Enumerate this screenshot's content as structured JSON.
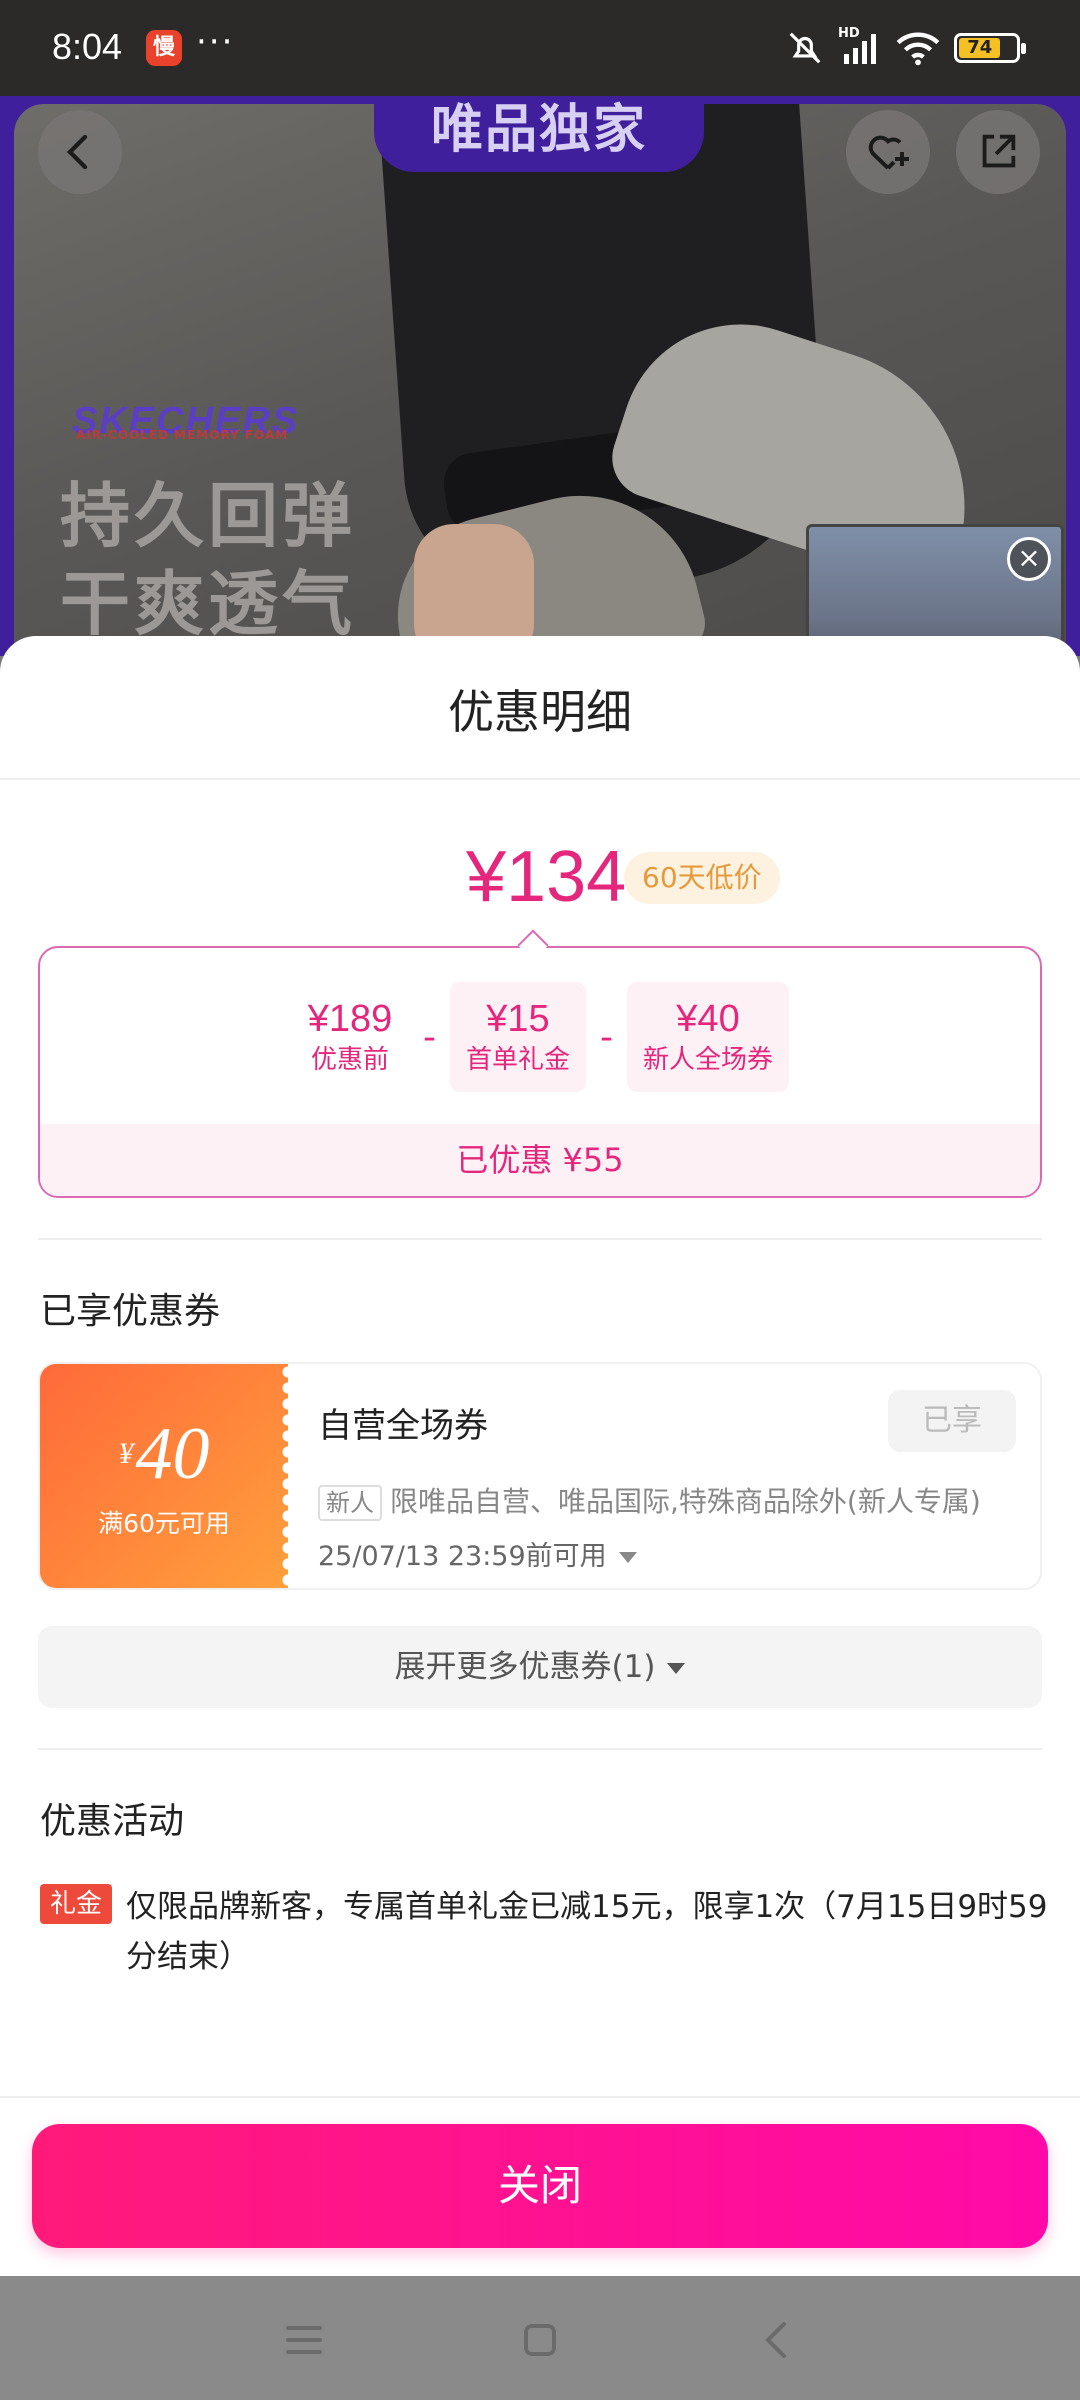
{
  "status_bar": {
    "time": "8:04",
    "app_icon_text": "慢",
    "dots": "···",
    "signal_label": "HD",
    "battery": "74"
  },
  "hero": {
    "banner": "唯品独家",
    "brand": "SKECHERS",
    "brand_sub": "AIR-COOLED MEMORY FOAM",
    "slogan_line1": "持久回弹",
    "slogan_line2": "干爽透气"
  },
  "sheet": {
    "title": "优惠明细",
    "final_price": "¥134",
    "low_price_tag": "60天低价",
    "breakdown": [
      {
        "value": "¥189",
        "label": "优惠前"
      },
      {
        "value": "¥15",
        "label": "首单礼金"
      },
      {
        "value": "¥40",
        "label": "新人全场券"
      }
    ],
    "operator": "-",
    "saved": "已优惠 ¥55"
  },
  "coupons_section": {
    "title": "已享优惠券",
    "coupon": {
      "currency": "¥",
      "amount": "40",
      "condition": "满60元可用",
      "name": "自营全场券",
      "button": "已享",
      "tag": "新人",
      "description": "限唯品自营、唯品国际,特殊商品除外(新人专属)",
      "expiry": "25/07/13 23:59前可用"
    },
    "expand": "展开更多优惠券(1)"
  },
  "promo_section": {
    "title": "优惠活动",
    "tag": "礼金",
    "text": "仅限品牌新客，专属首单礼金已减15元，限享1次（7月15日9时59分结束）"
  },
  "close_button": "关闭",
  "colors": {
    "accent": "#e4277c",
    "hero_bg": "#3f1f9c",
    "coupon_gradient_start": "#ff6a3a",
    "coupon_gradient_end": "#ffa03c",
    "close_button": "#ff1a7a"
  },
  "icons": {
    "back": "chevron-left-icon",
    "favorite": "heart-plus-icon",
    "share": "share-icon",
    "thumb_close": "close-icon",
    "nav_menu": "menu-icon",
    "nav_home": "home-icon",
    "nav_back": "back-icon"
  }
}
